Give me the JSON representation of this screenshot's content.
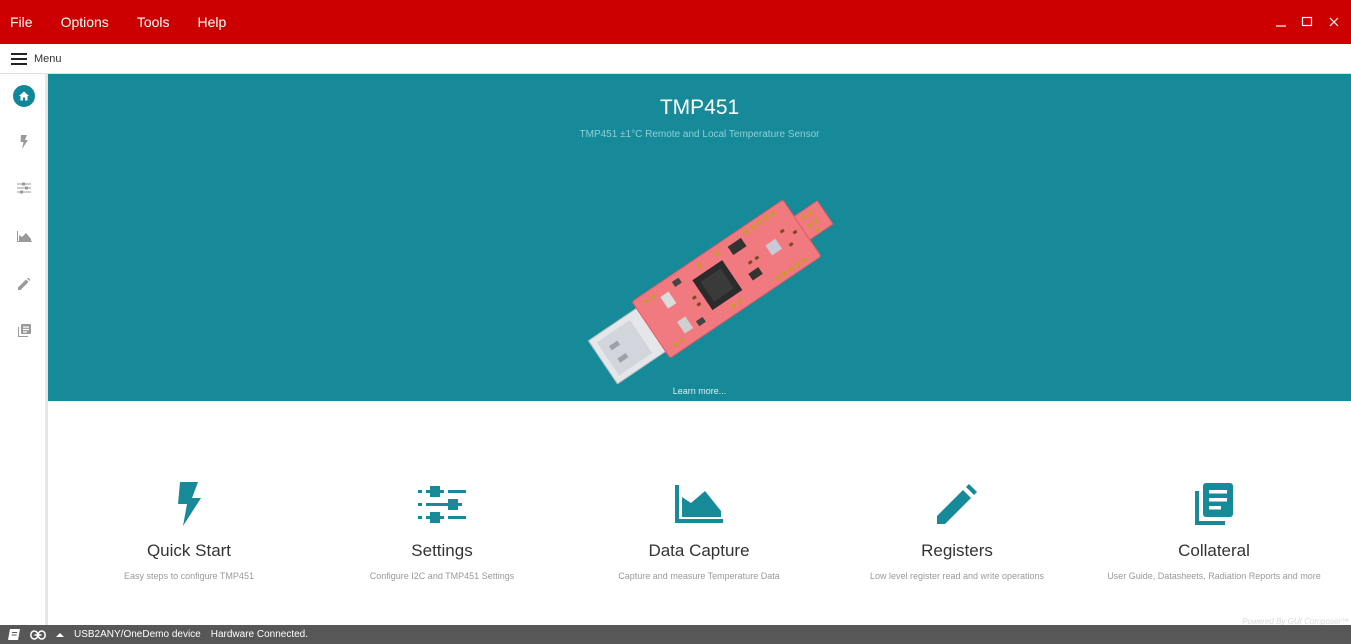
{
  "titlebar": {
    "menus": [
      "File",
      "Options",
      "Tools",
      "Help"
    ],
    "color": "#cc0000"
  },
  "menubar": {
    "label": "Menu"
  },
  "sidebar": {
    "items": [
      "home-icon",
      "lightning-icon",
      "sliders-icon",
      "area-chart-icon",
      "pencil-icon",
      "document-icon"
    ],
    "accent": "#118899"
  },
  "hero": {
    "title": "TMP451",
    "subtitle": "TMP451 ±1°C Remote and Local Temperature Sensor",
    "learn_more": "Learn more...",
    "background": "#168a98"
  },
  "cards": [
    {
      "title": "Quick Start",
      "description": "Easy steps to configure TMP451",
      "icon": "lightning-icon"
    },
    {
      "title": "Settings",
      "description": "Configure I2C and TMP451 Settings",
      "icon": "sliders-icon"
    },
    {
      "title": "Data Capture",
      "description": "Capture and measure Temperature Data",
      "icon": "area-chart-icon"
    },
    {
      "title": "Registers",
      "description": "Low level register read and write operations",
      "icon": "pencil-icon"
    },
    {
      "title": "Collateral",
      "description": "User Guide, Datasheets, Radiation Reports and more",
      "icon": "document-icon"
    }
  ],
  "footer": {
    "powered_by": "Powered By GUI Composer™"
  },
  "statusbar": {
    "device": "USB2ANY/OneDemo device",
    "status": "Hardware Connected."
  }
}
